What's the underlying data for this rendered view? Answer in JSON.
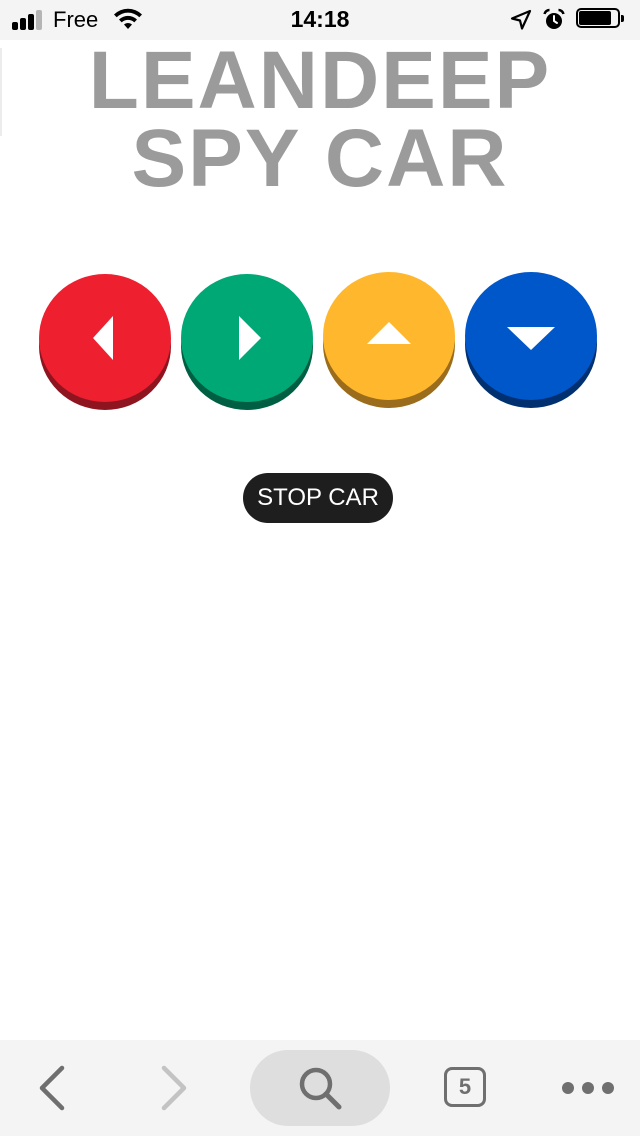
{
  "status_bar": {
    "carrier": "Free",
    "time": "14:18",
    "signal_bars_filled": 3,
    "signal_bars_total": 4,
    "battery_level": 0.85,
    "icons": [
      "wifi-icon",
      "location-arrow-icon",
      "alarm-clock-icon",
      "battery-icon"
    ]
  },
  "title": {
    "line1": "LEANDEEP",
    "line2": "SPY CAR",
    "color": "#9b9b9b"
  },
  "controls": [
    {
      "id": "left",
      "icon": "arrow-left-icon",
      "color": "#ee1f2f",
      "shade": "#8e1520"
    },
    {
      "id": "right",
      "icon": "arrow-right-icon",
      "color": "#00a876",
      "shade": "#005e43"
    },
    {
      "id": "up",
      "icon": "arrow-up-icon",
      "color": "#ffb82e",
      "shade": "#9a6c1c"
    },
    {
      "id": "down",
      "icon": "arrow-down-icon",
      "color": "#0057c9",
      "shade": "#003070"
    }
  ],
  "stop_button": {
    "label": "STOP CAR"
  },
  "toolbar": {
    "tab_count": "5",
    "icons": [
      "back-icon",
      "forward-icon",
      "search-icon",
      "tabs-icon",
      "more-icon"
    ]
  }
}
